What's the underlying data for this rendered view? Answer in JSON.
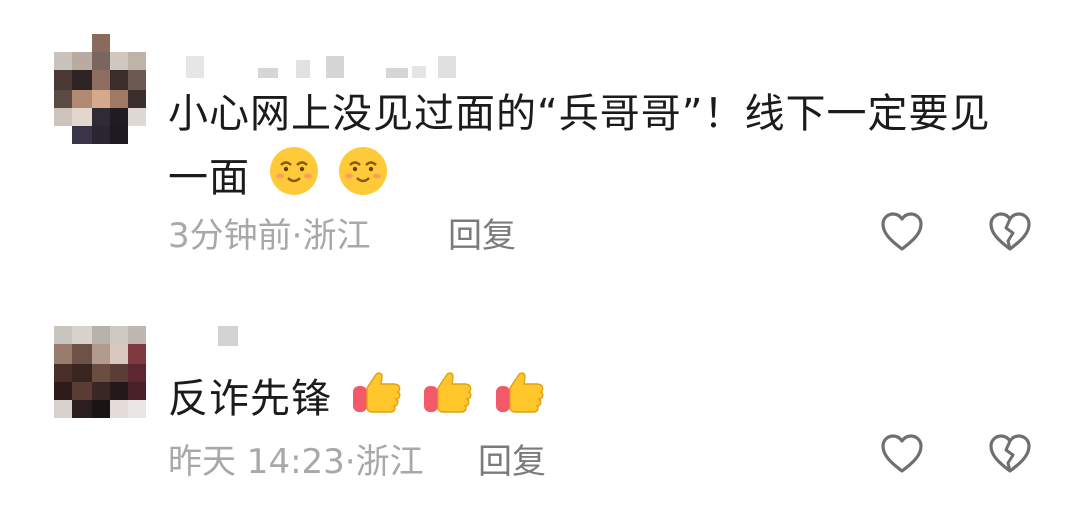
{
  "comments": [
    {
      "text_line1": "小心网上没见过面的“兵哥哥”！线下一定要见",
      "text_line2": "一面",
      "emojis": [
        "smiling-face-icon",
        "smiling-face-icon"
      ],
      "time": "3分钟前",
      "separator": "·",
      "location": "浙江",
      "reply_label": "回复",
      "like_icon": "heart-outline-icon",
      "dislike_icon": "broken-heart-icon"
    },
    {
      "text_line1": "反诈先锋",
      "emojis": [
        "thumbs-up-icon",
        "thumbs-up-icon",
        "thumbs-up-icon"
      ],
      "time": "昨天 14:23",
      "separator": "·",
      "location": "浙江",
      "reply_label": "回复",
      "like_icon": "heart-outline-icon",
      "dislike_icon": "broken-heart-icon"
    }
  ],
  "colors": {
    "text": "#1b1b1b",
    "meta": "#a8a8a8",
    "reply": "#7b7b7b",
    "icon": "#6f6f6f",
    "emoji_face": "#ffca3a",
    "thumb": "#ffc72c",
    "sleeve": "#f25a6a"
  }
}
